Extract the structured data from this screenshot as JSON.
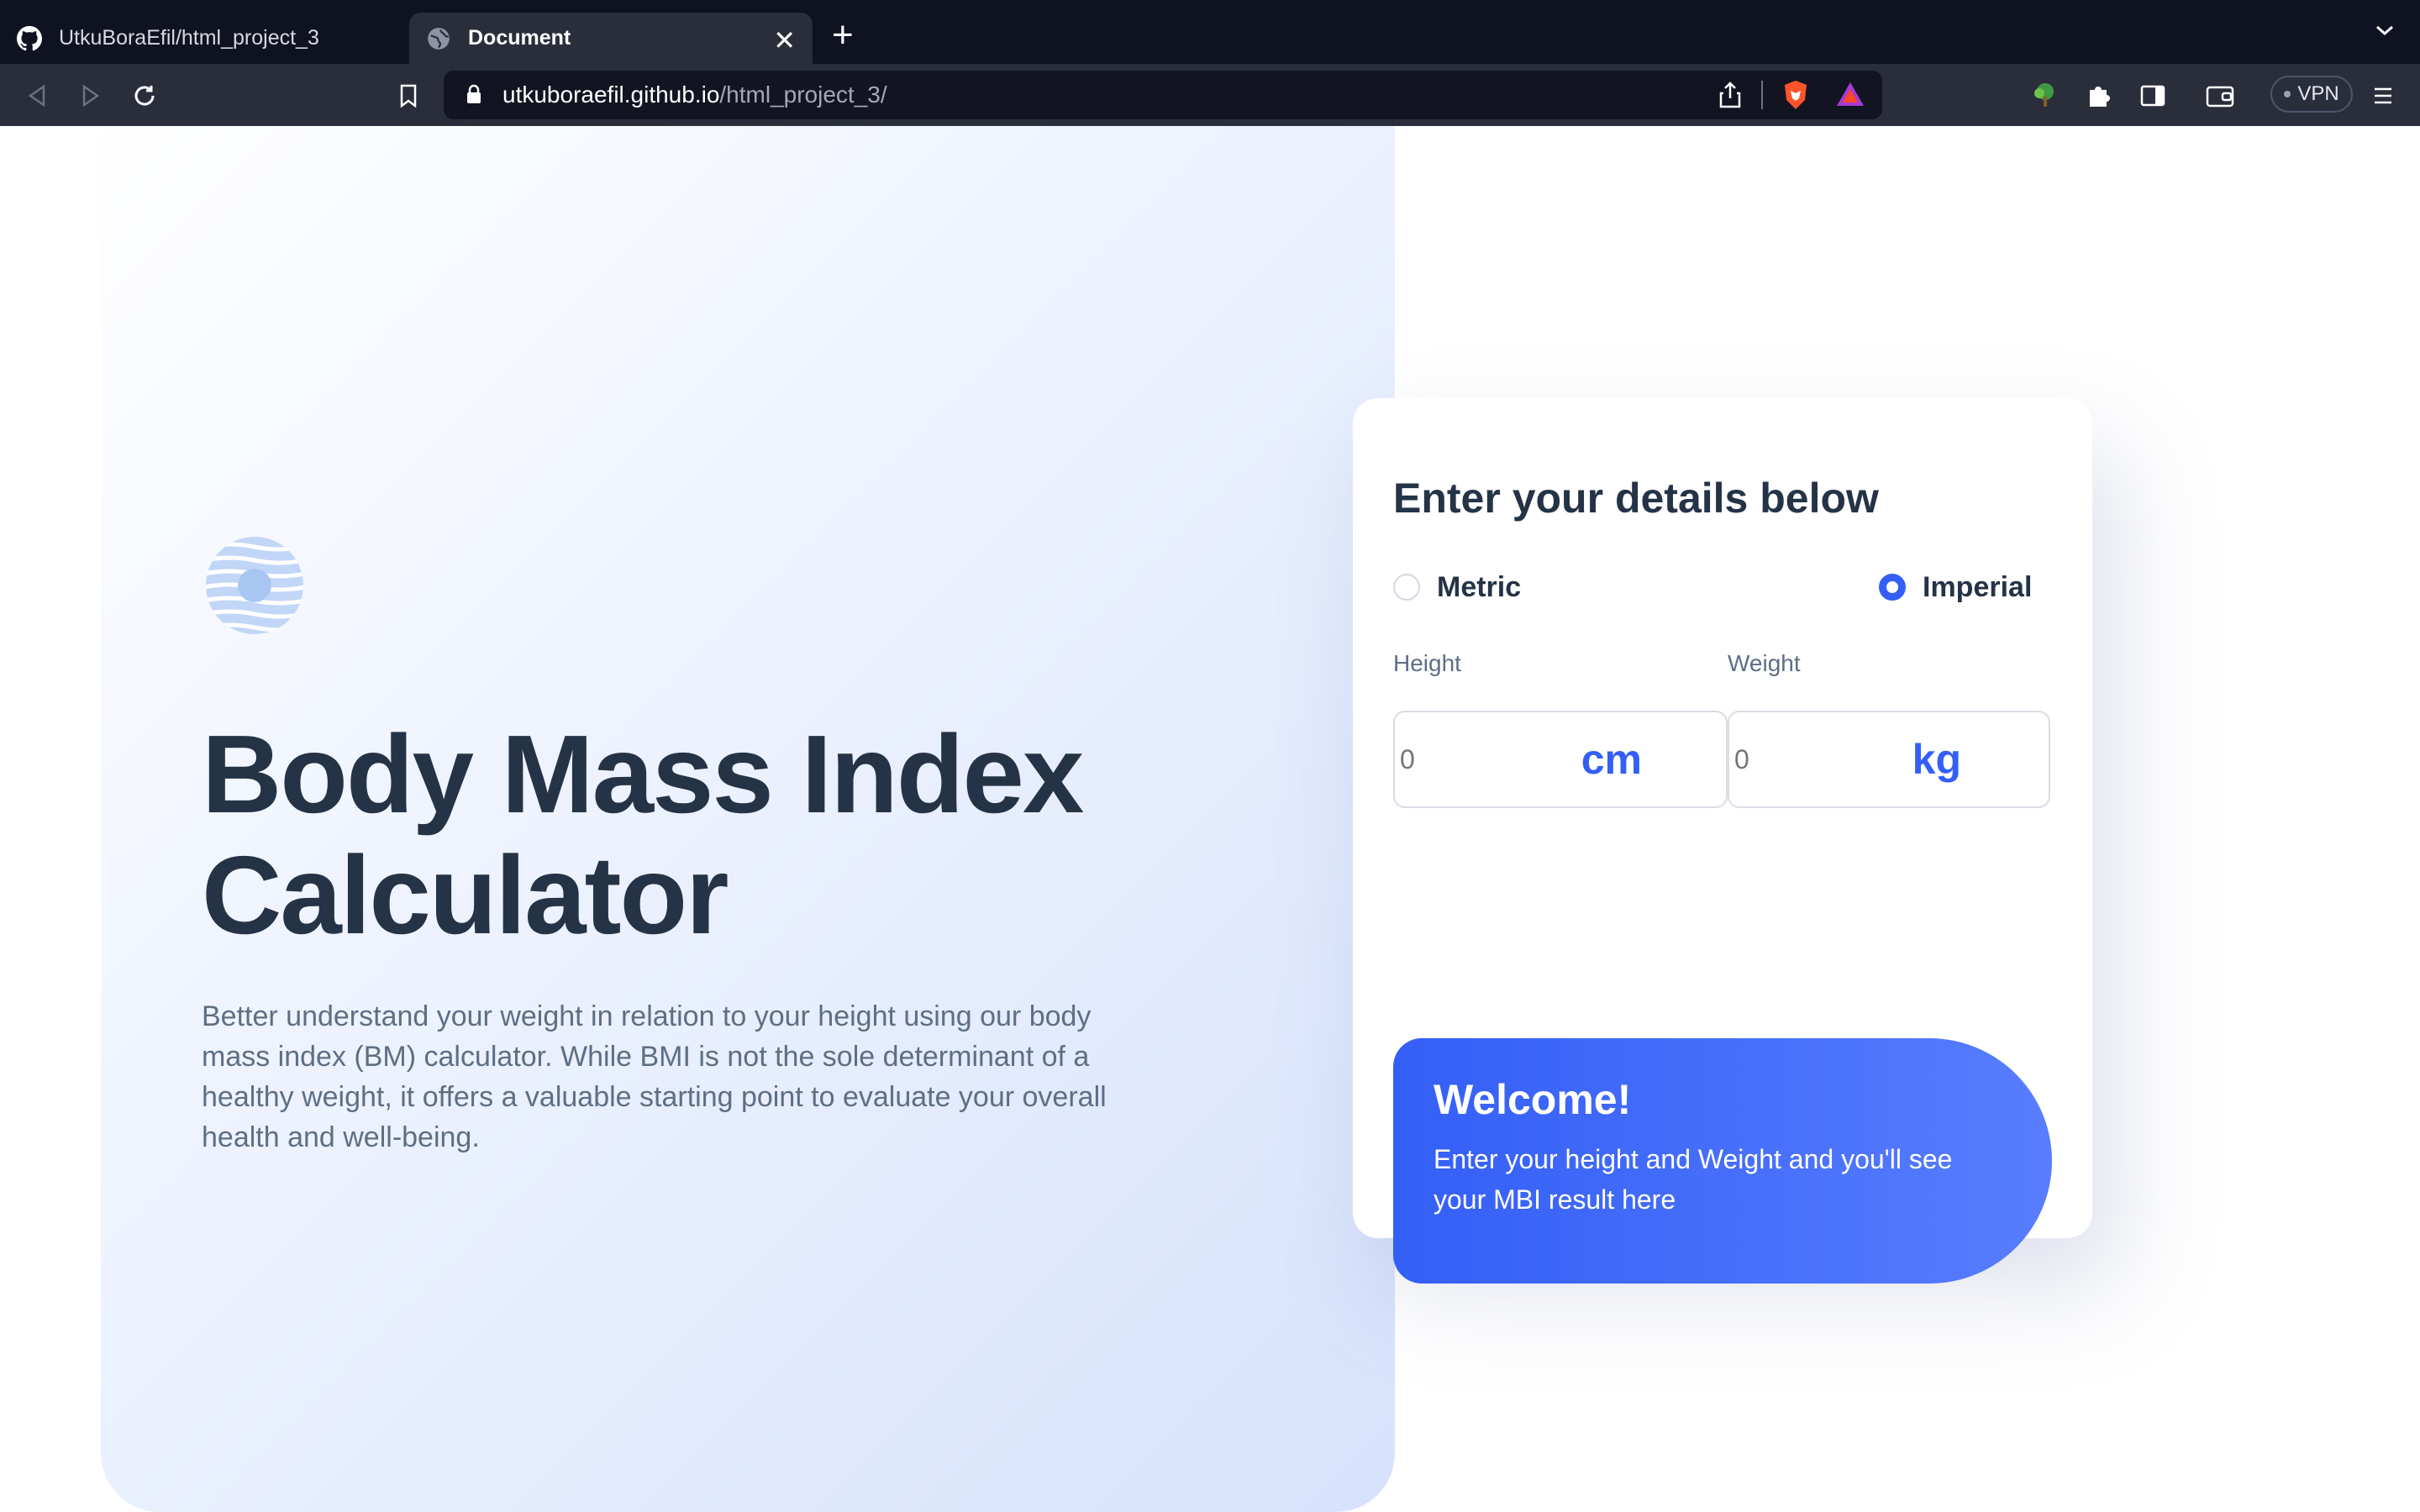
{
  "browser": {
    "tabs": [
      {
        "label": "UtkuBoraEfil/html_project_3",
        "icon": "github-icon",
        "active": false
      },
      {
        "label": "Document",
        "icon": "globe-icon",
        "active": true
      }
    ],
    "url": {
      "host": "utkuboraefil.github.io",
      "path": "/html_project_3/"
    },
    "vpn_label": "VPN"
  },
  "hero": {
    "title": "Body Mass Index Calculator",
    "description": "Better understand your weight in relation to your height using our body mass index (BM) calculator. While BMI is not the sole determinant of a healthy weight, it offers a valuable starting point to evaluate your overall health and well-being."
  },
  "form": {
    "heading": "Enter your details below",
    "units": [
      {
        "label": "Metric",
        "selected": false
      },
      {
        "label": "Imperial",
        "selected": true
      }
    ],
    "height": {
      "label": "Height",
      "placeholder": "0",
      "unit": "cm"
    },
    "weight": {
      "label": "Weight",
      "placeholder": "0",
      "unit": "kg"
    }
  },
  "result": {
    "heading": "Welcome!",
    "text": "Enter your height and Weight and you'll see your MBI result here"
  },
  "colors": {
    "accent": "#345ff6",
    "text_dark": "#253347",
    "text_muted": "#5e6e85",
    "chrome_dark": "#0f1220",
    "chrome_toolbar": "#2a2e3b"
  }
}
